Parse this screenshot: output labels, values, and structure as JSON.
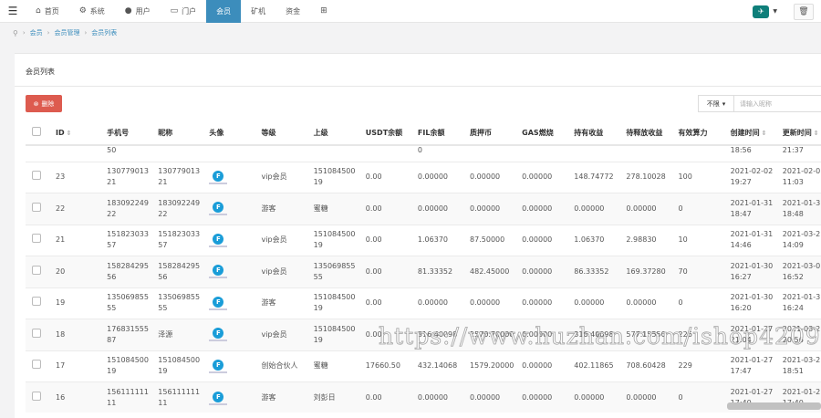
{
  "nav": {
    "menu_icon": "☰",
    "items": [
      {
        "icon": "home-icon",
        "glyph": "⌂",
        "label": "首页"
      },
      {
        "icon": "gear-icon",
        "glyph": "⚙",
        "label": "系统"
      },
      {
        "icon": "user-icon",
        "glyph": "●",
        "label": "用户"
      },
      {
        "icon": "portal-icon",
        "glyph": "▭",
        "label": "门户"
      },
      {
        "icon": "",
        "glyph": "",
        "label": "会员"
      },
      {
        "icon": "",
        "glyph": "",
        "label": "矿机"
      },
      {
        "icon": "",
        "glyph": "",
        "label": "资金"
      },
      {
        "icon": "grid-icon",
        "glyph": "⊞",
        "label": ""
      }
    ],
    "active_index": 4,
    "trash_glyph": "🗑"
  },
  "breadcrumb": {
    "items": [
      "会员",
      "会员管理",
      "会员列表"
    ]
  },
  "panel": {
    "title": "会员列表",
    "delete_label": "删除",
    "filter_value": "不限",
    "search_placeholder": "请输入昵称"
  },
  "table": {
    "headers": [
      "",
      "ID",
      "手机号",
      "昵称",
      "头像",
      "等级",
      "上级",
      "USDT余额",
      "FIL余额",
      "质押币",
      "GAS燃烧",
      "持有收益",
      "待释放收益",
      "有效算力",
      "创建时间",
      "更新时间"
    ],
    "partial_row": [
      "",
      "",
      "50",
      "",
      "",
      "",
      "",
      "",
      "0",
      "",
      "",
      "",
      "",
      "",
      "18:56",
      "21:37"
    ],
    "rows": [
      [
        "",
        "23",
        "130779013\n21",
        "130779013\n21",
        "F",
        "vip会员",
        "151084500\n19",
        "0.00",
        "0.00000",
        "0.00000",
        "0.00000",
        "148.74772",
        "278.10028",
        "100",
        "2021-02-02\n19:27",
        "2021-02-0\n11:03"
      ],
      [
        "",
        "22",
        "183092249\n22",
        "183092249\n22",
        "F",
        "游客",
        "蜜糖",
        "0.00",
        "0.00000",
        "0.00000",
        "0.00000",
        "0.00000",
        "0.00000",
        "0",
        "2021-01-31\n18:47",
        "2021-01-3\n18:48"
      ],
      [
        "",
        "21",
        "151823033\n57",
        "151823033\n57",
        "F",
        "vip会员",
        "151084500\n19",
        "0.00",
        "1.06370",
        "87.50000",
        "0.00000",
        "1.06370",
        "2.98830",
        "10",
        "2021-01-31\n14:46",
        "2021-03-2\n14:09"
      ],
      [
        "",
        "20",
        "158284295\n56",
        "158284295\n56",
        "F",
        "vip会员",
        "135069855\n55",
        "0.00",
        "81.33352",
        "482.45000",
        "0.00000",
        "86.33352",
        "169.37280",
        "70",
        "2021-01-30\n16:27",
        "2021-03-0\n16:52"
      ],
      [
        "",
        "19",
        "135069855\n55",
        "135069855\n55",
        "F",
        "游客",
        "151084500\n19",
        "0.00",
        "0.00000",
        "0.00000",
        "0.00000",
        "0.00000",
        "0.00000",
        "0",
        "2021-01-30\n16:20",
        "2021-01-3\n16:24"
      ],
      [
        "",
        "18",
        "176831555\n87",
        "泽源",
        "F",
        "vip会员",
        "151084500\n19",
        "0.00",
        "316.40098",
        "1570.70000",
        "0.00000",
        "316.40098",
        "577.15550",
        "226",
        "2021-01-27\n21:04",
        "2021-03-2\n20:56"
      ],
      [
        "",
        "17",
        "151084500\n19",
        "151084500\n19",
        "F",
        "创始合伙人",
        "蜜糖",
        "17660.50",
        "432.14068",
        "1579.20000",
        "0.00000",
        "402.11865",
        "708.60428",
        "229",
        "2021-01-27\n17:47",
        "2021-03-2\n18:51"
      ],
      [
        "",
        "16",
        "156111111\n11",
        "156111111\n11",
        "F",
        "游客",
        "刘彭日",
        "0.00",
        "0.00000",
        "0.00000",
        "0.00000",
        "0.00000",
        "0.00000",
        "0",
        "2021-01-27\n17:40",
        "2021-01-2\n17:40"
      ]
    ]
  },
  "watermark": "https://www.huzhan.com/ishop42090",
  "colors": {
    "active_nav": "#3c8dbc",
    "delete_button": "#dd5b4f",
    "link": "#3c8dbc"
  }
}
